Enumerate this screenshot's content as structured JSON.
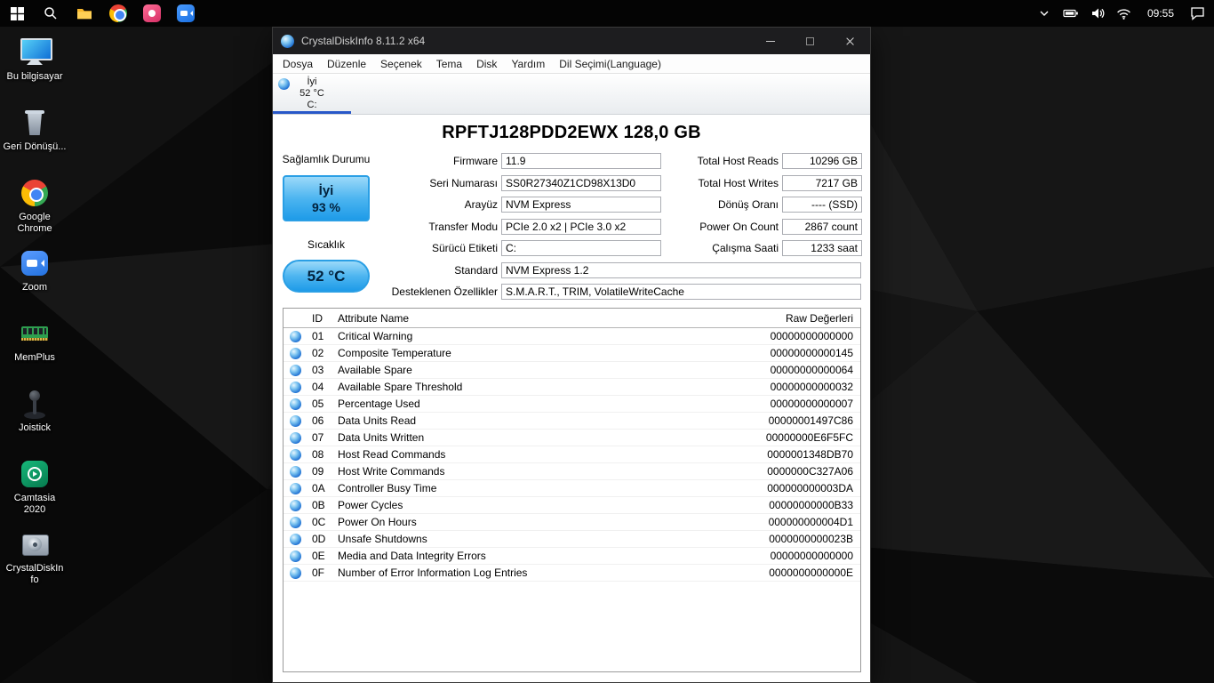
{
  "colors": {
    "health_good_fill": "#4db5f0",
    "health_border": "#2a9fe5",
    "tab_underline": "#2857c8",
    "taskbar_bg": "#040404"
  },
  "taskbar": {
    "time": "09:55"
  },
  "desktop": {
    "icons": [
      {
        "label": "Bu bilgisayar",
        "kind": "k-pc"
      },
      {
        "label": "Geri Dönüşü...",
        "kind": "k-recycle"
      },
      {
        "label": "Google Chrome",
        "kind": "k-chrome"
      },
      {
        "label": "Zoom",
        "kind": "k-zoom"
      },
      {
        "label": "MemPlus",
        "kind": "k-memplus"
      },
      {
        "label": "Joistick",
        "kind": "k-joystick"
      },
      {
        "label": "Camtasia 2020",
        "kind": "k-camtasia"
      },
      {
        "label": "CrystalDiskIn fo",
        "kind": "k-cdi"
      }
    ]
  },
  "window": {
    "title": "CrystalDiskInfo 8.11.2 x64",
    "menu": [
      "Dosya",
      "Düzenle",
      "Seçenek",
      "Tema",
      "Disk",
      "Yardım",
      "Dil Seçimi(Language)"
    ],
    "disk_tab": {
      "health": "İyi",
      "temp": "52 °C",
      "drive": "C:"
    },
    "model": "RPFTJ128PDD2EWX 128,0 GB",
    "health": {
      "label": "Sağlamlık Durumu",
      "status": "İyi",
      "percent": "93 %"
    },
    "temperature": {
      "label": "Sıcaklık",
      "value": "52 °C"
    },
    "info_fields": [
      {
        "label": "Firmware",
        "value": "11.9"
      },
      {
        "label": "Seri Numarası",
        "value": "SS0R27340Z1CD98X13D0"
      },
      {
        "label": "Arayüz",
        "value": "NVM Express"
      },
      {
        "label": "Transfer Modu",
        "value": "PCIe 2.0 x2 | PCIe 3.0 x2"
      },
      {
        "label": "Sürücü Etiketi",
        "value": "C:"
      },
      {
        "label": "Standard",
        "value": "NVM Express 1.2",
        "kind": "wide"
      },
      {
        "label": "Desteklenen Özellikler",
        "value": "S.M.A.R.T., TRIM, VolatileWriteCache",
        "kind": "wide"
      }
    ],
    "usage_fields": [
      {
        "label": "Total Host Reads",
        "value": "10296 GB"
      },
      {
        "label": "Total Host Writes",
        "value": "7217 GB"
      },
      {
        "label": "Dönüş Oranı",
        "value": "---- (SSD)"
      },
      {
        "label": "Power On Count",
        "value": "2867 count"
      },
      {
        "label": "Çalışma Saati",
        "value": "1233 saat"
      }
    ],
    "smart": {
      "headers": {
        "id": "ID",
        "name": "Attribute Name",
        "raw": "Raw Değerleri"
      },
      "rows": [
        {
          "id": "01",
          "name": "Critical Warning",
          "raw": "00000000000000"
        },
        {
          "id": "02",
          "name": "Composite Temperature",
          "raw": "00000000000145"
        },
        {
          "id": "03",
          "name": "Available Spare",
          "raw": "00000000000064"
        },
        {
          "id": "04",
          "name": "Available Spare Threshold",
          "raw": "00000000000032"
        },
        {
          "id": "05",
          "name": "Percentage Used",
          "raw": "00000000000007"
        },
        {
          "id": "06",
          "name": "Data Units Read",
          "raw": "00000001497C86"
        },
        {
          "id": "07",
          "name": "Data Units Written",
          "raw": "00000000E6F5FC"
        },
        {
          "id": "08",
          "name": "Host Read Commands",
          "raw": "0000001348DB70"
        },
        {
          "id": "09",
          "name": "Host Write Commands",
          "raw": "0000000C327A06"
        },
        {
          "id": "0A",
          "name": "Controller Busy Time",
          "raw": "000000000003DA"
        },
        {
          "id": "0B",
          "name": "Power Cycles",
          "raw": "00000000000B33"
        },
        {
          "id": "0C",
          "name": "Power On Hours",
          "raw": "000000000004D1"
        },
        {
          "id": "0D",
          "name": "Unsafe Shutdowns",
          "raw": "0000000000023B"
        },
        {
          "id": "0E",
          "name": "Media and Data Integrity Errors",
          "raw": "00000000000000"
        },
        {
          "id": "0F",
          "name": "Number of Error Information Log Entries",
          "raw": "0000000000000E"
        }
      ]
    }
  }
}
